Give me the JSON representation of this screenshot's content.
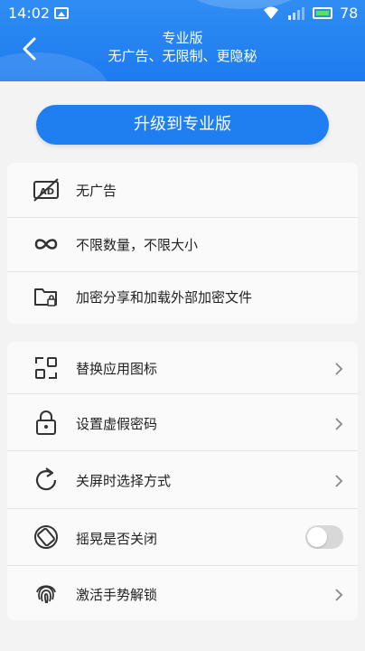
{
  "status_bar": {
    "time": "14:02",
    "battery_level": "78",
    "icons": [
      "image-icon",
      "wifi-icon",
      "signal-icon",
      "battery-icon"
    ]
  },
  "header": {
    "title": "专业版",
    "subtitle": "无广告、无限制、更隐秘",
    "back_icon": "back-arrow-icon"
  },
  "upgrade_button": {
    "label": "升级到专业版"
  },
  "features": [
    {
      "label": "无广告",
      "icon": "no-ad-icon"
    },
    {
      "label": "不限数量，不限大小",
      "icon": "infinity-icon"
    },
    {
      "label": "加密分享和加载外部加密文件",
      "icon": "locked-folder-icon"
    }
  ],
  "settings": [
    {
      "label": "替换应用图标",
      "icon": "swap-icon",
      "control": "chevron"
    },
    {
      "label": "设置虚假密码",
      "icon": "lock-icon",
      "control": "chevron"
    },
    {
      "label": "关屏时选择方式",
      "icon": "refresh-icon",
      "control": "chevron"
    },
    {
      "label": "摇晃是否关闭",
      "icon": "rotate-phone-icon",
      "control": "toggle",
      "toggle_on": false
    },
    {
      "label": "激活手势解锁",
      "icon": "fingerprint-icon",
      "control": "chevron"
    }
  ],
  "colors": {
    "header_blue": "#2f8df3",
    "button_blue": "#1f7ff0",
    "background": "#f3f3f3"
  }
}
